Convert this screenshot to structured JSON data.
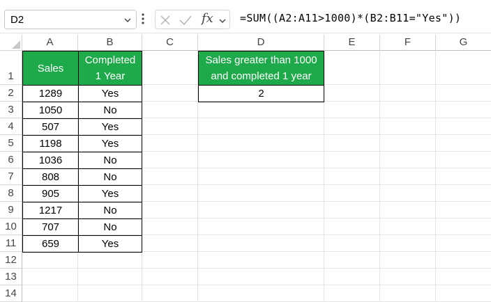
{
  "formula_bar": {
    "name_box": "D2",
    "formula": "=SUM((A2:A11>1000)*(B2:B11=\"Yes\"))",
    "fx_label": "fx"
  },
  "columns": [
    "A",
    "B",
    "C",
    "D",
    "E",
    "F",
    "G"
  ],
  "rows": [
    "1",
    "2",
    "3",
    "4",
    "5",
    "6",
    "7",
    "8",
    "9",
    "10",
    "11",
    "12",
    "13",
    "14"
  ],
  "table": {
    "header_a": "Sales",
    "header_b_line1": "Completed",
    "header_b_line2": "1 Year",
    "data": [
      {
        "sales": "1289",
        "completed": "Yes"
      },
      {
        "sales": "1050",
        "completed": "No"
      },
      {
        "sales": "507",
        "completed": "Yes"
      },
      {
        "sales": "1198",
        "completed": "Yes"
      },
      {
        "sales": "1036",
        "completed": "No"
      },
      {
        "sales": "808",
        "completed": "No"
      },
      {
        "sales": "905",
        "completed": "Yes"
      },
      {
        "sales": "1217",
        "completed": "No"
      },
      {
        "sales": "707",
        "completed": "No"
      },
      {
        "sales": "659",
        "completed": "Yes"
      }
    ]
  },
  "result": {
    "header_line1": "Sales greater than 1000",
    "header_line2": "and completed 1 year",
    "value": "2"
  },
  "colors": {
    "header_fill": "#1eaa4b",
    "header_text": "#ffffff"
  }
}
